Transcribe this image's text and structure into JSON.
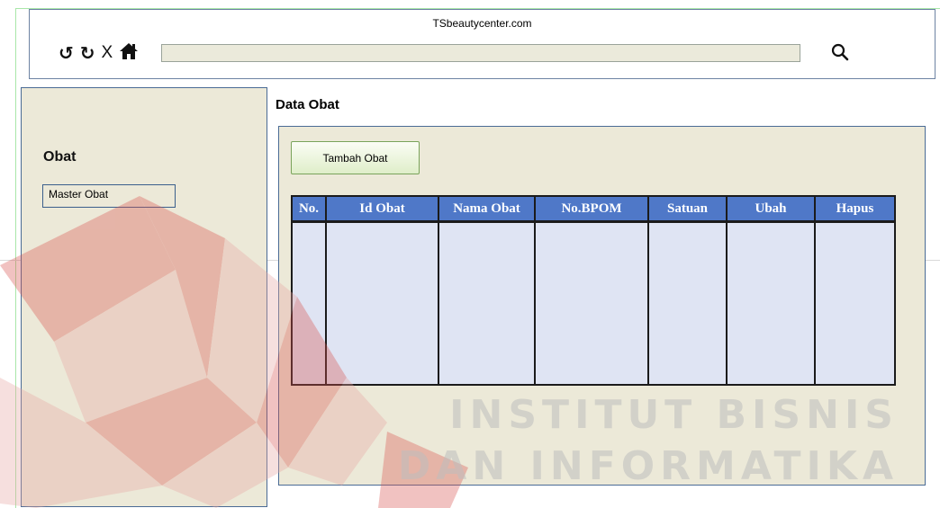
{
  "browser": {
    "site_title": "TSbeautycenter.com",
    "nav_icons": [
      "undo-icon",
      "refresh-icon",
      "close-icon",
      "home-icon"
    ],
    "search_icon": "search-icon"
  },
  "sidebar": {
    "title": "Obat",
    "items": [
      {
        "label": "Master Obat"
      }
    ]
  },
  "main": {
    "title": "Data Obat",
    "add_button": "Tambah Obat",
    "table": {
      "headers": [
        "No.",
        "Id Obat",
        "Nama Obat",
        "No.BPOM",
        "Satuan",
        "Ubah",
        "Hapus"
      ],
      "rows": []
    }
  },
  "watermark": {
    "line1": "INSTITUT BISNIS",
    "line2": "DAN INFORMATIKA"
  },
  "colors": {
    "panel_bg": "#ece9d8",
    "table_header": "#4f78c8",
    "table_body": "#dfe4f3",
    "border": "#4a6b95"
  }
}
